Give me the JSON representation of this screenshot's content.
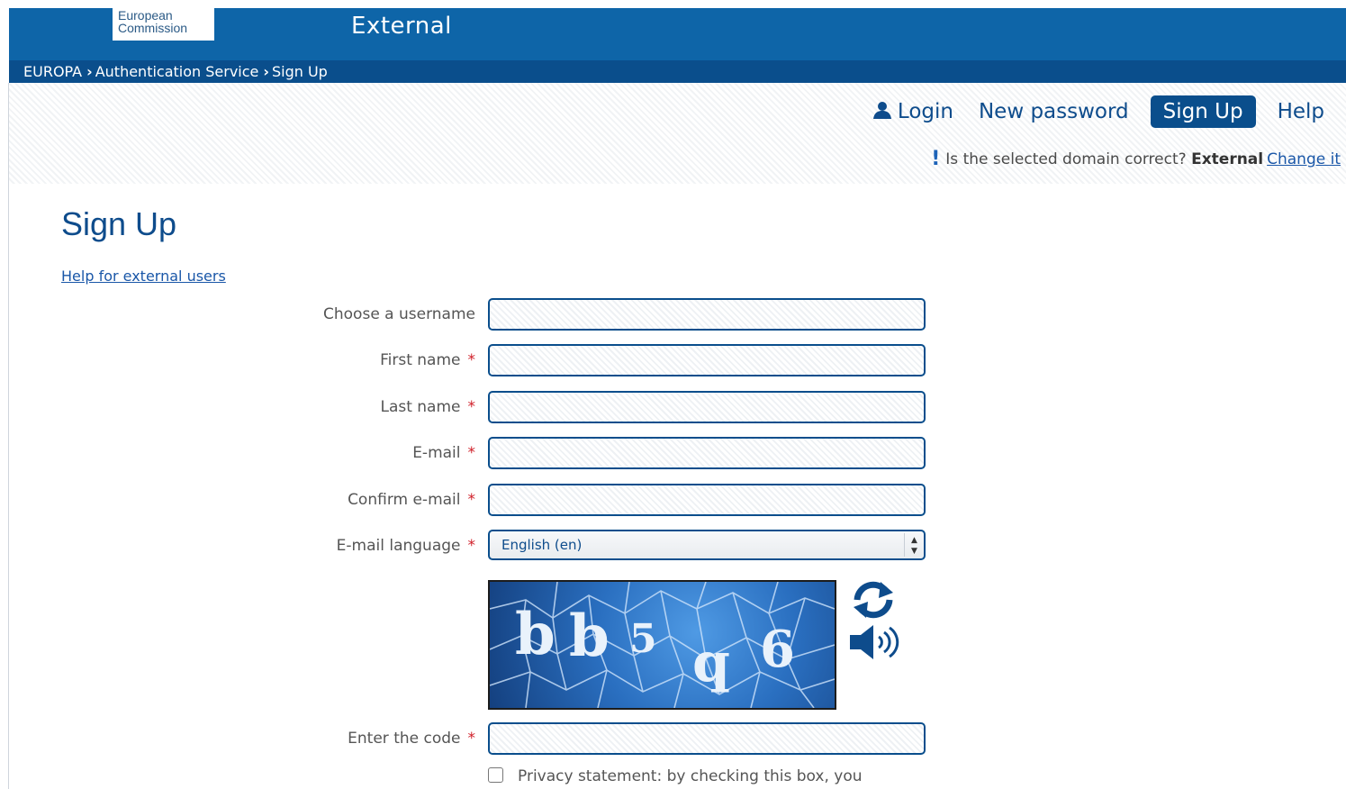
{
  "header": {
    "logo_line1": "European",
    "logo_line2": "Commission",
    "site_title": "External"
  },
  "breadcrumb": [
    "EUROPA",
    "Authentication Service",
    "Sign Up"
  ],
  "nav": {
    "login": "Login",
    "new_password": "New password",
    "sign_up": "Sign Up",
    "help": "Help"
  },
  "domain_notice": {
    "mark": "!",
    "question": "Is the selected domain correct?",
    "domain": "External",
    "change_link": "Change it"
  },
  "page": {
    "title": "Sign Up",
    "help_link": "Help for external users"
  },
  "form": {
    "required_mark": "*",
    "fields": [
      {
        "label": "Choose a username",
        "required": false
      },
      {
        "label": "First name",
        "required": true
      },
      {
        "label": "Last name",
        "required": true
      },
      {
        "label": "E-mail",
        "required": true
      },
      {
        "label": "Confirm e-mail",
        "required": true
      }
    ],
    "language": {
      "label": "E-mail language",
      "required": true,
      "selected": "English (en)"
    },
    "captcha": {
      "text": "bb5q6"
    },
    "code": {
      "label": "Enter the code",
      "required": true
    },
    "privacy_text": "Privacy statement: by checking this box, you"
  },
  "colors": {
    "brand_blue": "#0e65a8",
    "dark_blue": "#0a4e8c",
    "required_red": "#d0202a",
    "link_blue": "#1a57a8"
  }
}
